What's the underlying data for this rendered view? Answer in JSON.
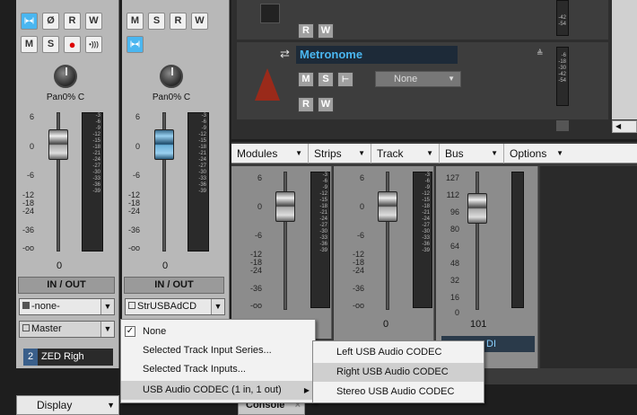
{
  "left_strips": [
    {
      "pan_label": "Pan",
      "pan_value": "0% C",
      "fader_value": "0",
      "io_label": "IN / OUT",
      "input": "-none-",
      "output": "Master",
      "track_num": "2",
      "track_name": "ZED Righ"
    },
    {
      "pan_label": "Pan",
      "pan_value": "0% C",
      "fader_value": "0",
      "io_label": "IN / OUT",
      "input": "StrUSBAdCD"
    }
  ],
  "strip_buttons": {
    "m": "M",
    "s": "S",
    "r": "R",
    "w": "W",
    "phase": "Ø"
  },
  "fader_scale": [
    "6",
    "0",
    "-6",
    "-12",
    "-18",
    "-24",
    "-36",
    "-oo"
  ],
  "meter_scale": [
    "-3",
    "-6",
    "-9",
    "-12",
    "-15",
    "-18",
    "-21",
    "-24",
    "-27",
    "-30",
    "-33",
    "-36",
    "-39"
  ],
  "track_meter_scale_a": [
    "-42",
    "-54"
  ],
  "track_meter_scale_b": [
    "-6",
    "-18",
    "-30",
    "-42",
    "-54"
  ],
  "metronome": {
    "name": "Metronome",
    "input": "None",
    "m": "M",
    "s": "S",
    "r": "R",
    "w": "W"
  },
  "console_tabs": [
    {
      "label": "Modules"
    },
    {
      "label": "Strips"
    },
    {
      "label": "Track"
    },
    {
      "label": "Bus"
    },
    {
      "label": "Options"
    }
  ],
  "midi_scale": [
    "127",
    "112",
    "96",
    "80",
    "64",
    "48",
    "32",
    "16",
    "0"
  ],
  "console_strips": {
    "strip2_value": "0",
    "strip3_value": "101",
    "midi_label": "DI"
  },
  "context_menu": {
    "items": [
      {
        "label": "None",
        "checked": true
      },
      {
        "label": "Selected Track Input Series..."
      },
      {
        "label": "Selected Track Inputs..."
      },
      {
        "label": "USB Audio CODEC  (1 in, 1 out)"
      }
    ]
  },
  "submenu": {
    "items": [
      {
        "label": "Left USB Audio CODEC"
      },
      {
        "label": "Right USB Audio CODEC",
        "selected": true
      },
      {
        "label": "Stereo USB Audio CODEC"
      }
    ]
  },
  "bottom": {
    "display_label": "Display",
    "console_label": "Console"
  },
  "colors": {
    "accent_blue": "#4ab6f0",
    "track_name": "#4ab6f0",
    "menu_bg": "#f2f2f2",
    "highlight": "#cfcfcf"
  }
}
